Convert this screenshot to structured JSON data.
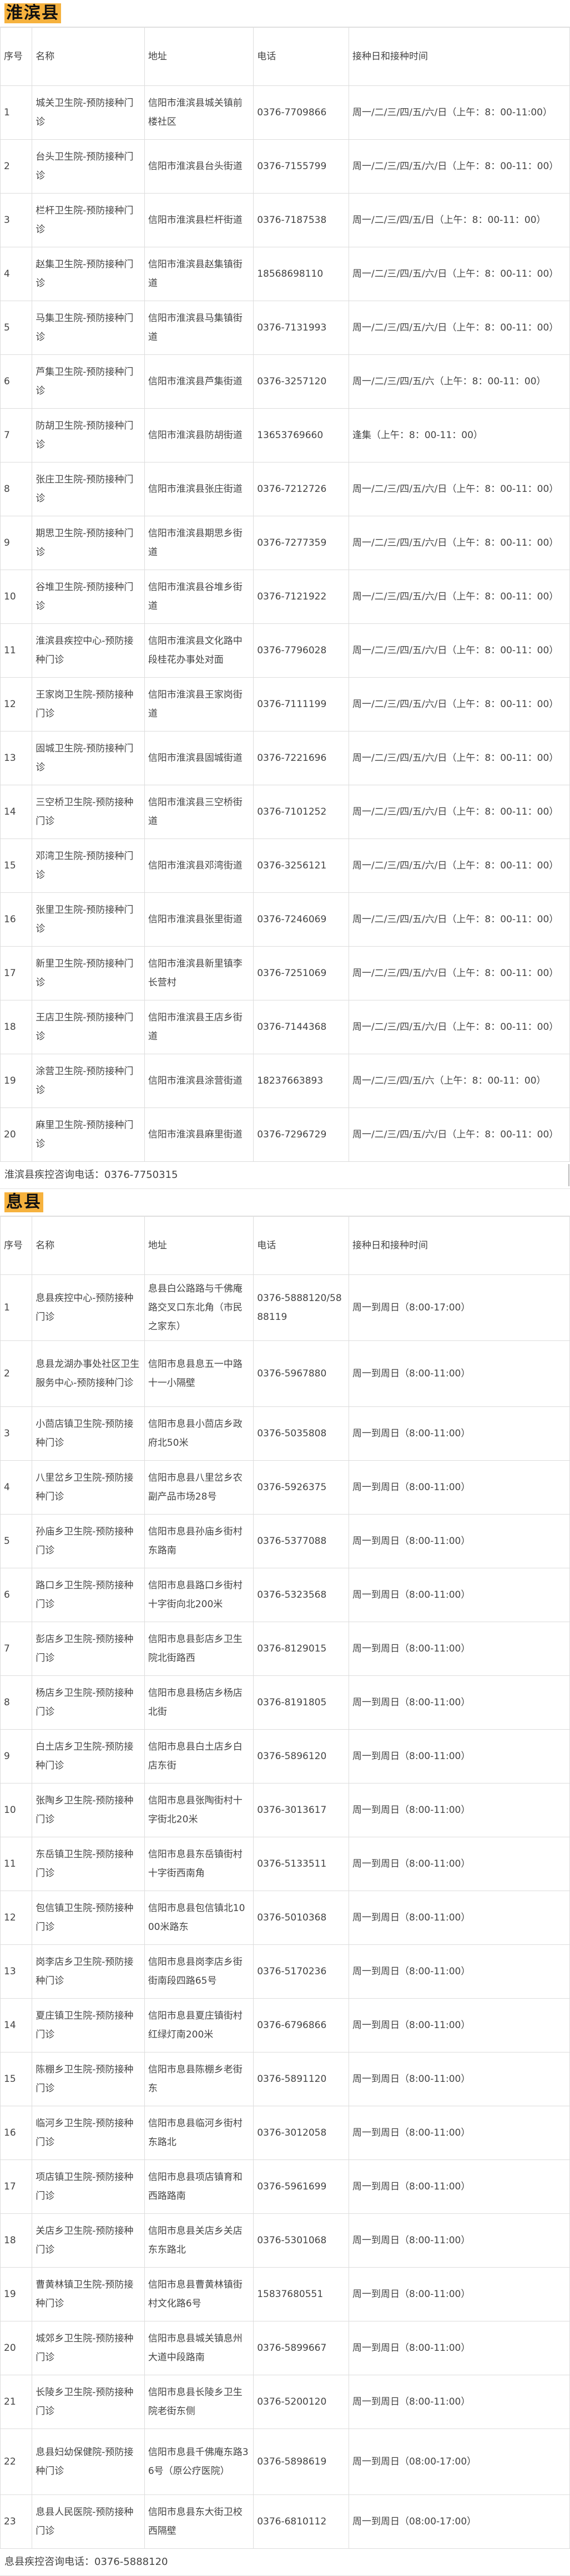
{
  "sections": [
    {
      "title": "淮滨县",
      "headers": [
        "序号",
        "名称",
        "地址",
        "电话",
        "接种日和接种时间"
      ],
      "rows": [
        [
          "1",
          "城关卫生院-预防接种门诊",
          "信阳市淮滨县城关镇前楼社区",
          "0376-7709866",
          "周一/二/三/四/五/六/日（上午：8：00-11:00）"
        ],
        [
          "2",
          "台头卫生院-预防接种门诊",
          "信阳市淮滨县台头街道",
          "0376-7155799",
          "周一/二/三/四/五/六/日（上午：8：00-11：00）"
        ],
        [
          "3",
          "栏杆卫生院-预防接种门诊",
          "信阳市淮滨县栏杆街道",
          "0376-7187538",
          "周一/二/三/四/五/日（上午：8：00-11：00）"
        ],
        [
          "4",
          "赵集卫生院-预防接种门诊",
          "信阳市淮滨县赵集镇街道",
          "18568698110",
          "周一/二/三/四/五/六/日（上午：8：00-11：00）"
        ],
        [
          "5",
          "马集卫生院-预防接种门诊",
          "信阳市淮滨县马集镇街道",
          "0376-7131993",
          "周一/二/三/四/五/六/日（上午：8：00-11：00）"
        ],
        [
          "6",
          "芦集卫生院-预防接种门诊",
          "信阳市淮滨县芦集街道",
          "0376-3257120",
          "周一/二/三/四/五/六（上午：8：00-11：00）"
        ],
        [
          "7",
          "防胡卫生院-预防接种门诊",
          "信阳市淮滨县防胡街道",
          "13653769660",
          "逢集（上午：8：00-11：00）"
        ],
        [
          "8",
          "张庄卫生院-预防接种门诊",
          "信阳市淮滨县张庄街道",
          "0376-7212726",
          "周一/二/三/四/五/六/日（上午：8：00-11：00）"
        ],
        [
          "9",
          "期思卫生院-预防接种门诊",
          "信阳市淮滨县期思乡街道",
          "0376-7277359",
          "周一/二/三/四/五/六/日（上午：8：00-11：00）"
        ],
        [
          "10",
          "谷堆卫生院-预防接种门诊",
          "信阳市淮滨县谷堆乡街道",
          "0376-7121922",
          "周一/二/三/四/五/六/日（上午：8：00-11：00）"
        ],
        [
          "11",
          "淮滨县疾控中心-预防接种门诊",
          "信阳市淮滨县文化路中段桂花办事处对面",
          "0376-7796028",
          "周一/二/三/四/五/六/日（上午：8：00-11：00）"
        ],
        [
          "12",
          "王家岗卫生院-预防接种门诊",
          "信阳市淮滨县王家岗街道",
          "0376-7111199",
          "周一/二/三/四/五/六/日（上午：8：00-11：00）"
        ],
        [
          "13",
          "固城卫生院-预防接种门诊",
          "信阳市淮滨县固城街道",
          "0376-7221696",
          "周一/二/三/四/五/六/日（上午：8：00-11：00）"
        ],
        [
          "14",
          "三空桥卫生院-预防接种门诊",
          "信阳市淮滨县三空桥街道",
          "0376-7101252",
          "周一/二/三/四/五/六/日（上午：8：00-11：00）"
        ],
        [
          "15",
          "邓湾卫生院-预防接种门诊",
          "信阳市淮滨县邓湾街道",
          "0376-3256121",
          "周一/二/三/四/五/六/日（上午：8：00-11：00）"
        ],
        [
          "16",
          "张里卫生院-预防接种门诊",
          "信阳市淮滨县张里街道",
          "0376-7246069",
          "周一/二/三/四/五/六/日（上午：8：00-11：00）"
        ],
        [
          "17",
          "新里卫生院-预防接种门诊",
          "信阳市淮滨县新里镇李长营村",
          "0376-7251069",
          "周一/二/三/四/五/六/日（上午：8：00-11：00）"
        ],
        [
          "18",
          "王店卫生院-预防接种门诊",
          "信阳市淮滨县王店乡街道",
          "0376-7144368",
          "周一/二/三/四/五/六/日（上午：8：00-11：00）"
        ],
        [
          "19",
          "涂营卫生院-预防接种门诊",
          "信阳市淮滨县涂营街道",
          "18237663893",
          "周一/二/三/四/五/六（上午：8：00-11：00）"
        ],
        [
          "20",
          "麻里卫生院-预防接种门诊",
          "信阳市淮滨县麻里街道",
          "0376-7296729",
          "周一/二/三/四/五/六/日（上午：8：00-11：00）"
        ]
      ],
      "footer": "淮滨县疾控咨询电话：0376-7750315"
    },
    {
      "title": "息县",
      "headers": [
        "序号",
        "名称",
        "地址",
        "电话",
        "接种日和接种时间"
      ],
      "rows": [
        [
          "1",
          "息县疾控中心-预防接种门诊",
          "息县白公路路与千佛庵路交叉口东北角（市民之家东）",
          "0376-5888120/5888119",
          "周一到周日（8:00-17:00）"
        ],
        [
          "2",
          "息县龙湖办事处社区卫生服务中心-预防接种门诊",
          "信阳市息县息五一中路十一小隔壁",
          "0376-5967880",
          "周一到周日（8:00-11:00）"
        ],
        [
          "3",
          "小茴店镇卫生院-预防接种门诊",
          "信阳市息县小茴店乡政府北50米",
          "0376-5035808",
          "周一到周日（8:00-11:00）"
        ],
        [
          "4",
          "八里岔乡卫生院-预防接种门诊",
          "信阳市息县八里岔乡农副产品市场28号",
          "0376-5926375",
          "周一到周日（8:00-11:00）"
        ],
        [
          "5",
          "孙庙乡卫生院-预防接种门诊",
          "信阳市息县孙庙乡街村东路南",
          "0376-5377088",
          "周一到周日（8:00-11:00）"
        ],
        [
          "6",
          "路口乡卫生院-预防接种门诊",
          "信阳市息县路口乡街村十字街向北200米",
          "0376-5323568",
          "周一到周日（8:00-11:00）"
        ],
        [
          "7",
          "彭店乡卫生院-预防接种门诊",
          "信阳市息县彭店乡卫生院北街路西",
          "0376-8129015",
          "周一到周日（8:00-11:00）"
        ],
        [
          "8",
          "杨店乡卫生院-预防接种门诊",
          "信阳市息县杨店乡杨店北街",
          "0376-8191805",
          "周一到周日（8:00-11:00）"
        ],
        [
          "9",
          "白土店乡卫生院-预防接种门诊",
          "信阳市息县白土店乡白店东街",
          "0376-5896120",
          "周一到周日（8:00-11:00）"
        ],
        [
          "10",
          "张陶乡卫生院-预防接种门诊",
          "信阳市息县张陶街村十字街北20米",
          "0376-3013617",
          "周一到周日（8:00-11:00）"
        ],
        [
          "11",
          "东岳镇卫生院-预防接种门诊",
          "信阳市息县东岳镇街村十字街西南角",
          "0376-5133511",
          "周一到周日（8:00-11:00）"
        ],
        [
          "12",
          "包信镇卫生院-预防接种门诊",
          "信阳市息县包信镇北1000米路东",
          "0376-5010368",
          "周一到周日（8:00-11:00）"
        ],
        [
          "13",
          "岗李店乡卫生院-预防接种门诊",
          "信阳市息县岗李店乡街街南段四路65号",
          "0376-5170236",
          "周一到周日（8:00-11:00）"
        ],
        [
          "14",
          "夏庄镇卫生院-预防接种门诊",
          "信阳市息县夏庄镇街村红绿灯南200米",
          "0376-6796866",
          "周一到周日（8:00-11:00）"
        ],
        [
          "15",
          "陈棚乡卫生院-预防接种门诊",
          "信阳市息县陈棚乡老街东",
          "0376-5891120",
          "周一到周日（8:00-11:00）"
        ],
        [
          "16",
          "临河乡卫生院-预防接种门诊",
          "信阳市息县临河乡街村东路北",
          "0376-3012058",
          "周一到周日（8:00-11:00）"
        ],
        [
          "17",
          "项店镇卫生院-预防接种门诊",
          "信阳市息县项店镇育和西路路南",
          "0376-5961699",
          "周一到周日（8:00-11:00）"
        ],
        [
          "18",
          "关店乡卫生院-预防接种门诊",
          "信阳市息县关店乡关店东东路北",
          "0376-5301068",
          "周一到周日（8:00-11:00）"
        ],
        [
          "19",
          "曹黄林镇卫生院-预防接种门诊",
          "信阳市息县曹黄林镇街村文化路6号",
          "15837680551",
          "周一到周日（8:00-11:00）"
        ],
        [
          "20",
          "城郊乡卫生院-预防接种门诊",
          "信阳市息县城关镇息州大道中段路南",
          "0376-5899667",
          "周一到周日（8:00-11:00）"
        ],
        [
          "21",
          "长陵乡卫生院-预防接种门诊",
          "信阳市息县长陵乡卫生院老街东侧",
          "0376-5200120",
          "周一到周日（8:00-11:00）"
        ],
        [
          "22",
          "息县妇幼保健院-预防接种门诊",
          "信阳市息县千佛庵东路36号（原公疗医院）",
          "0376-5898619",
          "周一到周日（08:00-17:00）"
        ],
        [
          "23",
          "息县人民医院-预防接种门诊",
          "信阳市息县东大街卫校西隔壁",
          "0376-6810112",
          "周一到周日（08:00-17:00）"
        ]
      ],
      "footer": "息县疾控咨询电话：0376-5888120"
    }
  ]
}
